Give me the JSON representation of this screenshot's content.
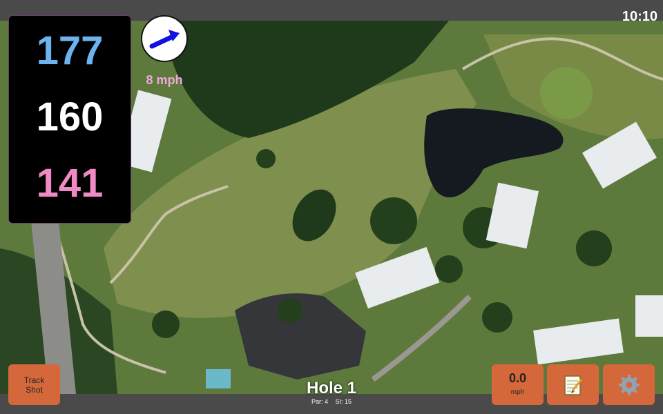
{
  "status": {
    "clock": "10:10"
  },
  "distances": {
    "back": "177",
    "middle": "160",
    "front": "141"
  },
  "wind": {
    "speed": "8 mph",
    "icon": "wind-arrow-icon"
  },
  "buttons": {
    "track_shot": {
      "line1": "Track",
      "line2": "Shot"
    },
    "wind_meter": {
      "value": "0.0",
      "unit": "mph"
    },
    "notes": {
      "icon": "notepad-icon"
    },
    "settings": {
      "icon": "gear-icon"
    }
  },
  "hole": {
    "title": "Hole 1",
    "par": "Par: 4",
    "si": "SI: 15"
  },
  "colors": {
    "back": "#6cb4f0",
    "middle": "#ffffff",
    "front": "#f08ac4",
    "button": "#d4683a",
    "wind_text": "#f0a8dc",
    "arrow": "#1010e0"
  }
}
